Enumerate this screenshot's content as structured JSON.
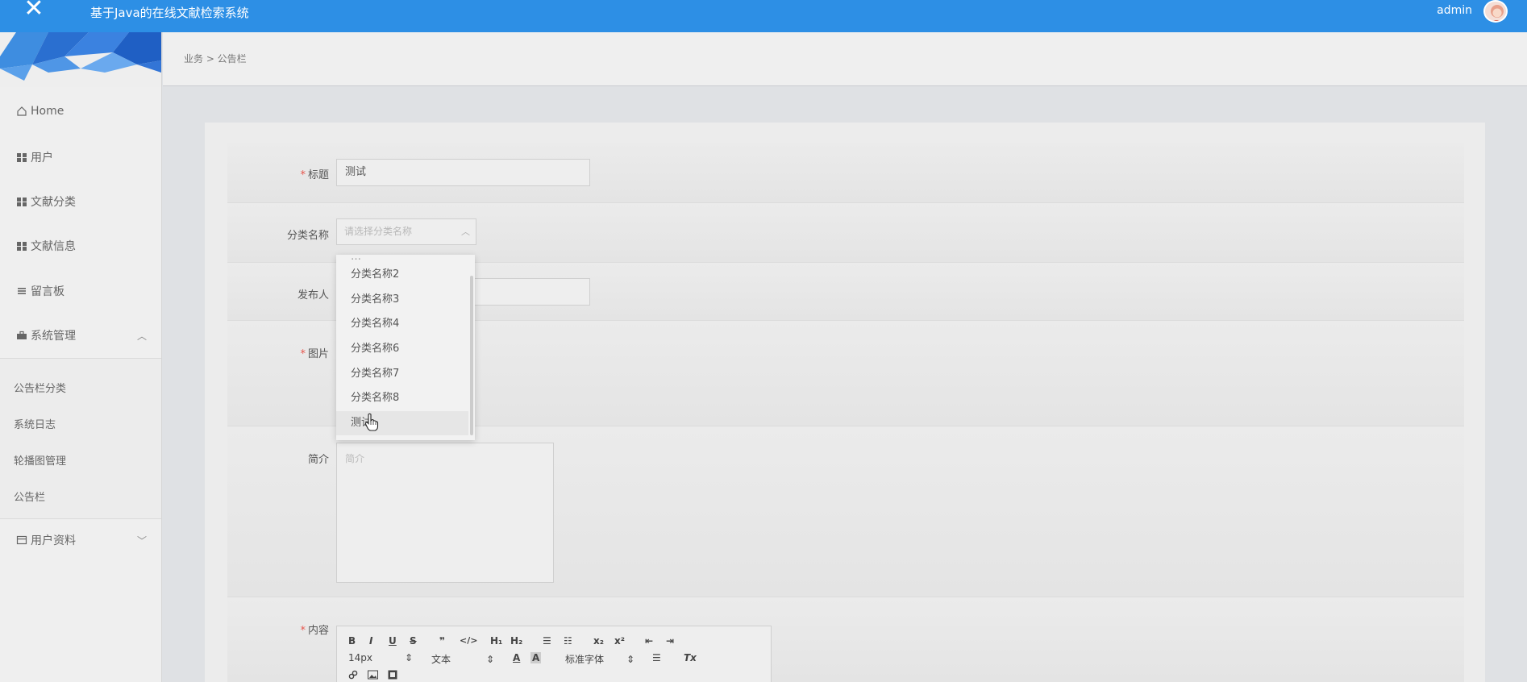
{
  "header": {
    "close_glyph": "✕",
    "title": "基于Java的在线文献检索系统",
    "username": "admin",
    "avatar_icon": "avatar-icon"
  },
  "sidebar": {
    "items": [
      {
        "label": "Home",
        "icon": "home-icon"
      },
      {
        "label": "用户",
        "icon": "grid-icon"
      },
      {
        "label": "文献分类",
        "icon": "grid-icon"
      },
      {
        "label": "文献信息",
        "icon": "grid-icon"
      },
      {
        "label": "留言板",
        "icon": "list-icon"
      },
      {
        "label": "系统管理",
        "icon": "briefcase-icon",
        "caret": "︿"
      },
      {
        "label": "用户资料",
        "icon": "card-icon",
        "caret": "﹀"
      }
    ],
    "sub_items": [
      "公告栏分类",
      "系统日志",
      "轮播图管理",
      "公告栏"
    ]
  },
  "breadcrumb": {
    "text": "业务 > 公告栏"
  },
  "form": {
    "title_label": "标题",
    "title_value": "测试",
    "category_label": "分类名称",
    "category_placeholder": "请选择分类名称",
    "publisher_label": "发布人",
    "image_label": "图片",
    "intro_label": "简介",
    "intro_placeholder": "简介",
    "content_label": "内容",
    "required_mark": "*"
  },
  "dropdown": {
    "options": [
      "分类名称2",
      "分类名称3",
      "分类名称4",
      "分类名称6",
      "分类名称7",
      "分类名称8",
      "测试"
    ],
    "hovered": "测试"
  },
  "editor": {
    "toolbar_row1": [
      "B",
      "I",
      "U",
      "S",
      "❞",
      "</>",
      "H₁",
      "H₂",
      "☰",
      "☷",
      "x₂",
      "x²",
      "⇤",
      "⇥"
    ],
    "font_size": "14px",
    "text_style": "文本",
    "font_family": "标准字体"
  },
  "colors": {
    "topbar": "#2d8fe5",
    "required": "#e7564d"
  }
}
